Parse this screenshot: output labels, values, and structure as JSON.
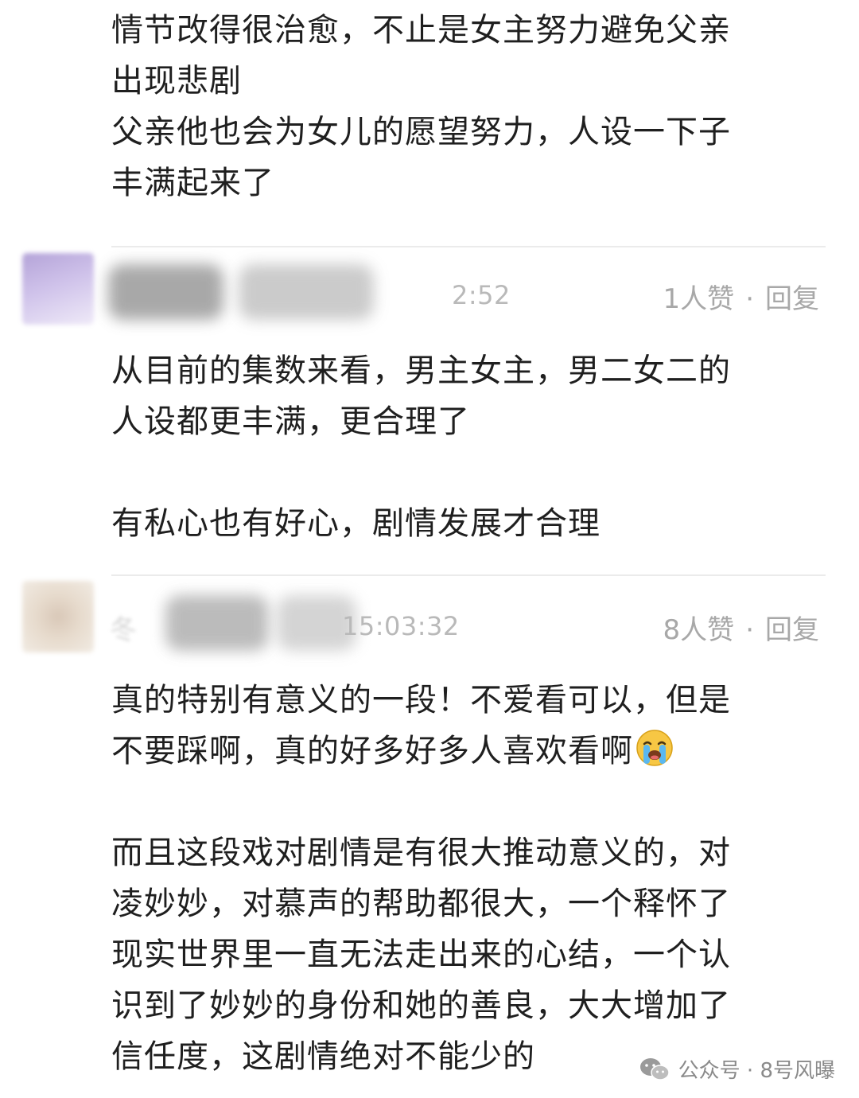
{
  "top_comment": {
    "lines": [
      "情节改得很治愈，不止是女主努力避免父亲",
      "出现悲剧",
      "父亲他也会为女儿的愿望努力，人设一下子",
      "丰满起来了"
    ]
  },
  "comments": [
    {
      "time_visible": "2:52",
      "likes": "1人赞",
      "separator": "·",
      "reply": "回复",
      "body_lines": [
        "从目前的集数来看，男主女主，男二女二的",
        "人设都更丰满，更合理了"
      ],
      "body_lines_2": [
        "有私心也有好心，剧情发展才合理"
      ]
    },
    {
      "name_partial": "冬",
      "time_visible": "15:03:32",
      "likes": "8人赞",
      "separator": "·",
      "reply": "回复",
      "body_line_1": "真的特别有意义的一段！不爱看可以，但是",
      "body_line_2": "不要踩啊，真的好多好多人喜欢看啊",
      "emoji": "loudly-crying-face",
      "body_lines_2": [
        "而且这段戏对剧情是有很大推动意义的，对",
        "凌妙妙，对慕声的帮助都很大，一个释怀了",
        "现实世界里一直无法走出来的心结，一个认",
        "识到了妙妙的身份和她的善良，大大增加了",
        "信任度，这剧情绝对不能少的"
      ]
    }
  ],
  "watermark": {
    "text": "公众号 · 8号风曝",
    "icon": "wechat-icon"
  },
  "colors": {
    "text": "#1f1f1f",
    "meta": "#a8a8a8",
    "divider": "#ebebeb"
  }
}
